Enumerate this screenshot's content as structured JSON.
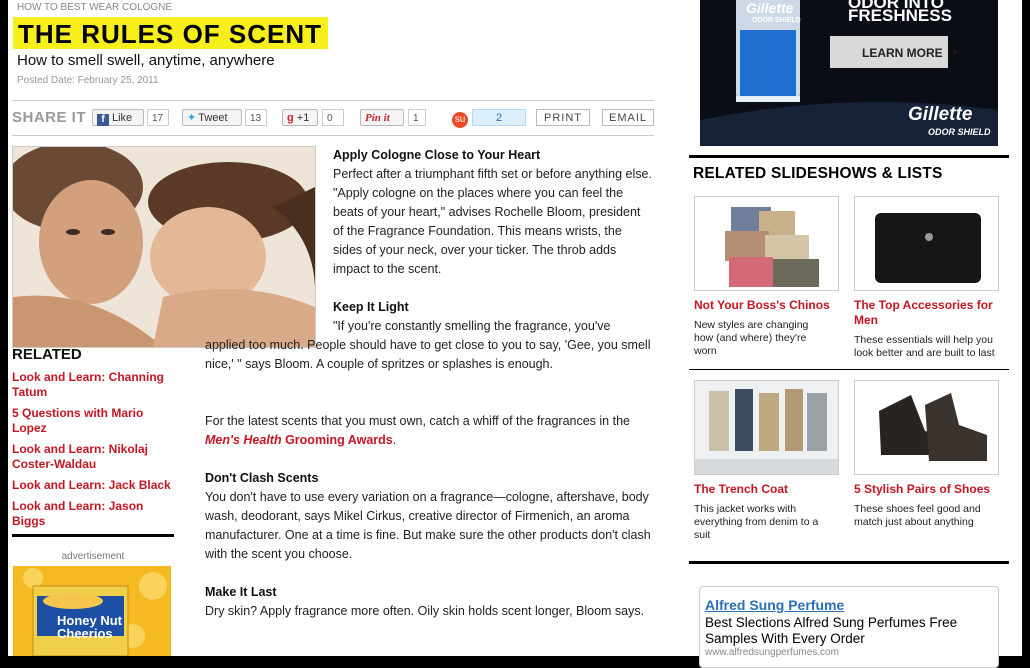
{
  "article": {
    "breadcrumb": "HOW TO BEST WEAR COLOGNE",
    "title": "THE RULES OF SCENT",
    "subtitle": "How to smell swell, anytime, anywhere",
    "posted": "Posted Date: February 25, 2011"
  },
  "share": {
    "label": "SHARE IT",
    "like_label": "Like",
    "like_count": "17",
    "tweet_label": "Tweet",
    "tweet_count": "13",
    "plus_label": "+1",
    "plus_count": "0",
    "pin_label": "Pin it",
    "pin_count": "1",
    "su_count": "2",
    "print_label": "PRINT",
    "email_label": "EMAIL"
  },
  "related": {
    "heading": "RELATED",
    "items": [
      {
        "label": "Look and Learn: Channing Tatum"
      },
      {
        "label": "5 Questions with Mario Lopez"
      },
      {
        "label": "Look and Learn: Nikolaj Coster-Waldau"
      },
      {
        "label": "Look and Learn: Jack Black"
      },
      {
        "label": "Look and Learn: Jason Biggs"
      }
    ],
    "ad_label": "advertisement",
    "cereal_text": "Honey Nut Cheerios"
  },
  "sections": [
    {
      "heading": "Apply Cologne Close to Your Heart",
      "body": "Perfect after a triumphant fifth set or before anything else. \"Apply cologne on the places where you can feel the beats of your heart,\" advises Rochelle Bloom, president of the Fragrance Foundation. This means wrists, the sides of your neck, over your ticker. The throb adds impact to the scent."
    },
    {
      "heading": "Keep It Light",
      "body": "\"If you're constantly smelling the fragrance, you've applied too much. People should have to get close to you to say, 'Gee, you smell nice,' \" says Bloom. A couple of spritzes or splashes is enough."
    },
    {
      "heading": "Don't Clash Scents",
      "body": "You don't have to use every variation on a fragrance—cologne, aftershave, body wash, deodorant, says Mikel Cirkus, creative director of Firmenich, an aroma manufacturer. One at a time is fine. But make sure the other products don't clash with the scent you choose."
    },
    {
      "heading": "Make It Last",
      "body": "Dry skin? Apply fragrance more often. Oily skin holds scent longer, Bloom says."
    }
  ],
  "promo": {
    "before": "For the latest scents that you must own, catch a whiff of the fragrances in the ",
    "link_italic": "Men's Health",
    "link_rest": " Grooming Awards",
    "after": "."
  },
  "gillette_ad": {
    "headline_line1": "ODOR INTO",
    "headline_line2": "FRESHNESS",
    "cta": "LEARN MORE",
    "brand": "Gillette",
    "sub_brand": "ODOR SHIELD",
    "product_brand": "Gillette",
    "product_sub": "ODOR SHIELD"
  },
  "slideshows": {
    "title": "RELATED SLIDESHOWS & LISTS",
    "cards": [
      {
        "title": "Not Your Boss's Chinos",
        "desc": "New styles are changing how (and where) they're worn"
      },
      {
        "title": "The Top Accessories for Men",
        "desc": "These essentials will help you look better and are built to last"
      },
      {
        "title": "The Trench Coat",
        "desc": "This jacket works with everything from denim to a suit"
      },
      {
        "title": "5 Stylish Pairs of Shoes",
        "desc": "These shoes feel good and match just about anything"
      }
    ]
  },
  "alfred_ad": {
    "title": "Alfred Sung Perfume",
    "body": "Best Slections Alfred Sung Perfumes Free Samples With Every Order",
    "url": "www.alfredsungperfumes.com"
  }
}
